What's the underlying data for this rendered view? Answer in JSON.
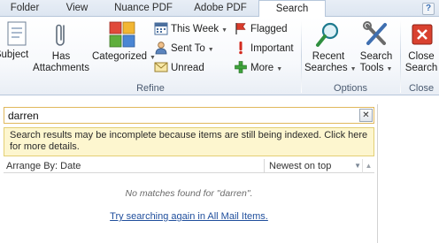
{
  "tabs": [
    {
      "label": "Folder",
      "active": false
    },
    {
      "label": "View",
      "active": false
    },
    {
      "label": "Nuance PDF",
      "active": false
    },
    {
      "label": "Adobe PDF",
      "active": false
    },
    {
      "label": "Search",
      "active": true
    }
  ],
  "help_label": "?",
  "ribbon": {
    "refine": {
      "label": "Refine",
      "subject": "Subject",
      "has_attachments_line1": "Has",
      "has_attachments_line2": "Attachments",
      "categorized": "Categorized",
      "this_week": "This Week",
      "sent_to": "Sent To",
      "unread": "Unread",
      "flagged": "Flagged",
      "important": "Important",
      "more": "More"
    },
    "options": {
      "label": "Options",
      "recent_searches_line1": "Recent",
      "recent_searches_line2": "Searches",
      "search_tools_line1": "Search",
      "search_tools_line2": "Tools"
    },
    "close": {
      "label": "Close",
      "close_search_line1": "Close",
      "close_search_line2": "Search"
    }
  },
  "search": {
    "query": "darren",
    "clear_label": "✕",
    "info": "Search results may be incomplete because items are still being indexed. Click here for more details."
  },
  "list": {
    "arrange_by": "Arrange By: Date",
    "sort_order": "Newest on top",
    "no_match": "No matches found for \"darren\".",
    "try_again": "Try searching again in All Mail Items."
  },
  "colors": {
    "accent": "#e0b85c",
    "info_bg": "#fdf6cf",
    "link": "#1f4e9c",
    "ribbon_border": "#b6c6da"
  }
}
